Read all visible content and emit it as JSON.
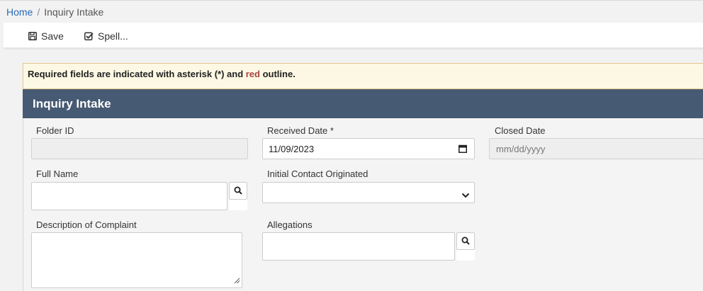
{
  "breadcrumb": {
    "home": "Home",
    "separator": "/",
    "current": "Inquiry Intake"
  },
  "toolbar": {
    "save_label": "Save",
    "spell_label": "Spell..."
  },
  "notice": {
    "part1": "Required fields are indicated with asterisk (*) and ",
    "red_word": "red",
    "part2": " outline."
  },
  "panel": {
    "title": "Inquiry Intake"
  },
  "form": {
    "folder_id": {
      "label": "Folder ID",
      "value": ""
    },
    "received_date": {
      "label": "Received Date *",
      "value": "11/09/2023"
    },
    "closed_date": {
      "label": "Closed Date",
      "placeholder": "mm/dd/yyyy"
    },
    "full_name": {
      "label": "Full Name",
      "value": ""
    },
    "initial_contact": {
      "label": "Initial Contact Originated",
      "value": ""
    },
    "description": {
      "label": "Description of Complaint",
      "value": ""
    },
    "allegations": {
      "label": "Allegations",
      "value": ""
    }
  },
  "icons": {
    "save": "floppy-disk-icon",
    "spell": "check-square-icon",
    "calendar": "calendar-icon",
    "dropdown": "chevron-down-icon",
    "search": "magnifier-icon"
  },
  "colors": {
    "link": "#2a6ab6",
    "header_bg": "#475a73",
    "notice_bg": "#fcf8e3",
    "required_red": "#a94442"
  }
}
